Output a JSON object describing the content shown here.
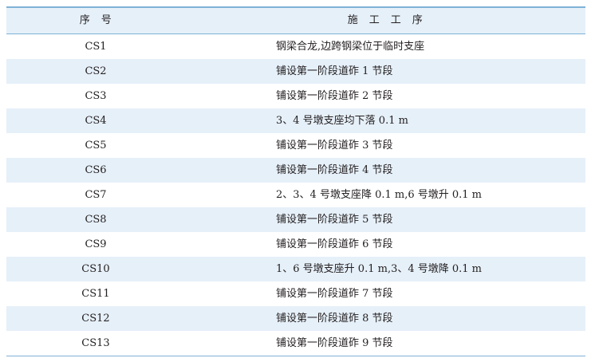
{
  "table": {
    "headers": {
      "seq": "序　号",
      "step": "施　工　工　序"
    },
    "rows": [
      {
        "seq": "CS1",
        "step": "钢梁合龙,边跨钢梁位于临时支座"
      },
      {
        "seq": "CS2",
        "step": "铺设第一阶段道砟 1 节段"
      },
      {
        "seq": "CS3",
        "step": "铺设第一阶段道砟 2 节段"
      },
      {
        "seq": "CS4",
        "step": "3、4 号墩支座均下落 0.1 m"
      },
      {
        "seq": "CS5",
        "step": "铺设第一阶段道砟 3 节段"
      },
      {
        "seq": "CS6",
        "step": "铺设第一阶段道砟 4 节段"
      },
      {
        "seq": "CS7",
        "step": "2、3、4 号墩支座降 0.1 m,6 号墩升 0.1 m"
      },
      {
        "seq": "CS8",
        "step": "铺设第一阶段道砟 5 节段"
      },
      {
        "seq": "CS9",
        "step": "铺设第一阶段道砟 6 节段"
      },
      {
        "seq": "CS10",
        "step": "1、6 号墩支座升 0.1 m,3、4 号墩降 0.1 m"
      },
      {
        "seq": "CS11",
        "step": "铺设第一阶段道砟 7 节段"
      },
      {
        "seq": "CS12",
        "step": "铺设第一阶段道砟 8 节段"
      },
      {
        "seq": "CS13",
        "step": "铺设第一阶段道砟 9 节段"
      }
    ]
  },
  "colors": {
    "rule": "#7fb2d6",
    "shade": "#e6f0f9",
    "text": "#231f20"
  }
}
